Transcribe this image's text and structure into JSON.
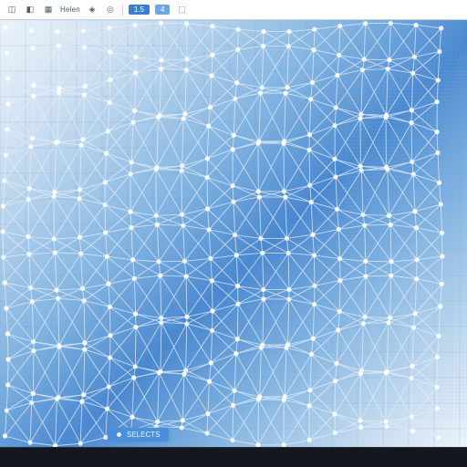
{
  "toolbar": {
    "items": [
      {
        "icon": "◫",
        "name": "grid-icon"
      },
      {
        "icon": "◧",
        "name": "split-icon"
      },
      {
        "icon": "▦",
        "name": "cells-icon"
      },
      {
        "label": "Helen",
        "name": "helen-label"
      },
      {
        "icon": "◈",
        "name": "diamond-icon"
      },
      {
        "icon": "◎",
        "name": "target-icon"
      },
      {
        "sep": true
      },
      {
        "accent": "1.5",
        "name": "badge-1"
      },
      {
        "accent": "4",
        "light": true,
        "name": "badge-2"
      },
      {
        "icon": "⬚",
        "name": "box-icon"
      }
    ]
  },
  "status": {
    "label": "SELECTS"
  },
  "canvas": {
    "rows": 17,
    "cols": 18,
    "row_spacing": 28,
    "col_spacing": 28,
    "amplitude": 14,
    "node_radius": 2.6,
    "grid_color": "#6b9dcf",
    "fine_grid_color": "#8fbce8",
    "mesh_color": "#e3eefa",
    "node_color": "#ffffff"
  }
}
